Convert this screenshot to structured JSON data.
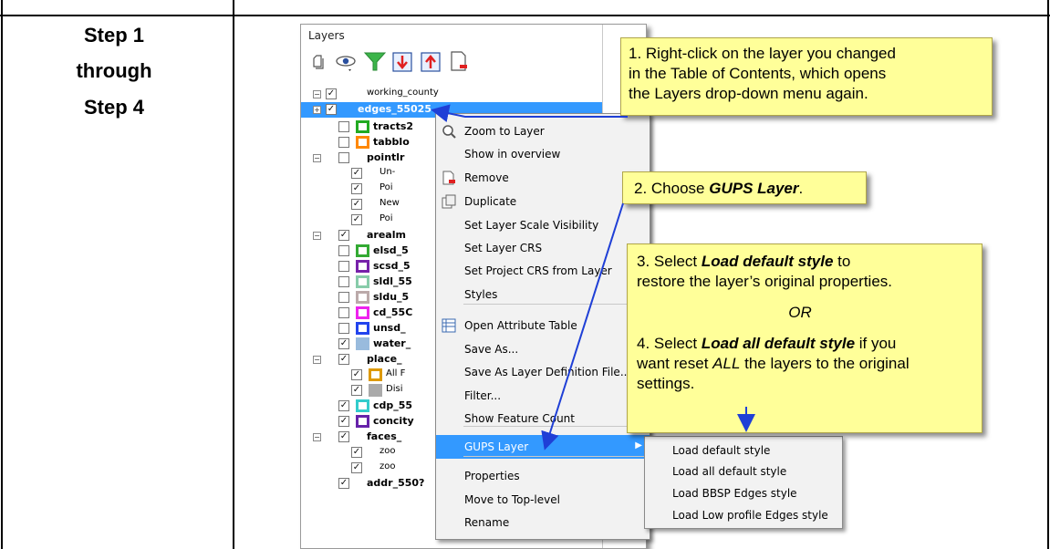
{
  "step_label": [
    "Step 1",
    "through",
    "Step 4"
  ],
  "panel": {
    "title": "Layers",
    "root_layer": "working_county",
    "selected_layer": "edges_55025",
    "layers": [
      {
        "label": "tracts2",
        "swatch": "#22aa22"
      },
      {
        "label": "tabblo",
        "swatch": "#ff8800"
      },
      {
        "label": "pointlr"
      },
      {
        "label": "Un-",
        "sub": true
      },
      {
        "label": "Poi",
        "sub": true
      },
      {
        "label": "New",
        "sub": true
      },
      {
        "label": "Poi",
        "sub": true
      },
      {
        "label": "arealm"
      },
      {
        "label": "elsd_5",
        "swatch": "#33aa33"
      },
      {
        "label": "scsd_5",
        "swatch": "#7722aa"
      },
      {
        "label": "sldl_55",
        "swatch": "#88ccaa"
      },
      {
        "label": "sldu_5",
        "swatch": "#bbaaaa"
      },
      {
        "label": "cd_55C",
        "swatch": "#ee22ee"
      },
      {
        "label": "unsd_",
        "swatch": "#2244ee"
      },
      {
        "label": "water_",
        "swatch": "#99bbdd"
      },
      {
        "label": "place_"
      },
      {
        "label": "All F",
        "sub": true,
        "swatch": "#dd9900"
      },
      {
        "label": "Disi",
        "sub": true,
        "swatch": "#aaaaaa"
      },
      {
        "label": "cdp_55",
        "swatch": "#33cccc"
      },
      {
        "label": "concity",
        "swatch": "#6622aa"
      },
      {
        "label": "faces_"
      },
      {
        "label": "zoo",
        "sub": true
      },
      {
        "label": "zoo",
        "sub": true
      },
      {
        "label": "addr_550?"
      }
    ]
  },
  "context_menu": {
    "items": [
      "Zoom to Layer",
      "Show in overview",
      "Remove",
      "Duplicate",
      "Set Layer Scale Visibility",
      "Set Layer CRS",
      "Set Project CRS from Layer",
      "Styles",
      "Open Attribute Table",
      "Save As...",
      "Save As Layer Definition File...",
      "Filter...",
      "Show Feature Count",
      "GUPS Layer",
      "Properties",
      "Move to Top-level",
      "Rename"
    ],
    "highlighted": "GUPS Layer"
  },
  "submenu": {
    "items": [
      "Load default style",
      "Load all default style",
      "Load BBSP Edges style",
      "Load Low profile Edges style"
    ]
  },
  "callouts": {
    "c1": [
      "1. Right-click on the layer you changed",
      "in the Table of Contents, which opens",
      "the Layers drop-down menu again."
    ],
    "c2_prefix": "2. Choose ",
    "c2_bold": "GUPS Layer",
    "c2_suffix": ".",
    "c3_prefix": "3.   Select ",
    "c3_bold": "Load default style",
    "c3_suffix": " to",
    "c3_line2": "restore the layer’s original properties.",
    "or": "OR",
    "c4_prefix": "4.  Select ",
    "c4_bold": "Load all default style",
    "c4_suffix": " if you",
    "c4_line2_prefix": "want reset ",
    "c4_line2_it": "ALL",
    "c4_line2_suffix": " the layers to the original",
    "c4_line3": "settings."
  },
  "colors": {
    "callout_bg": "#ffff99",
    "selection": "#3399ff",
    "arrow": "#1f3fd6"
  }
}
